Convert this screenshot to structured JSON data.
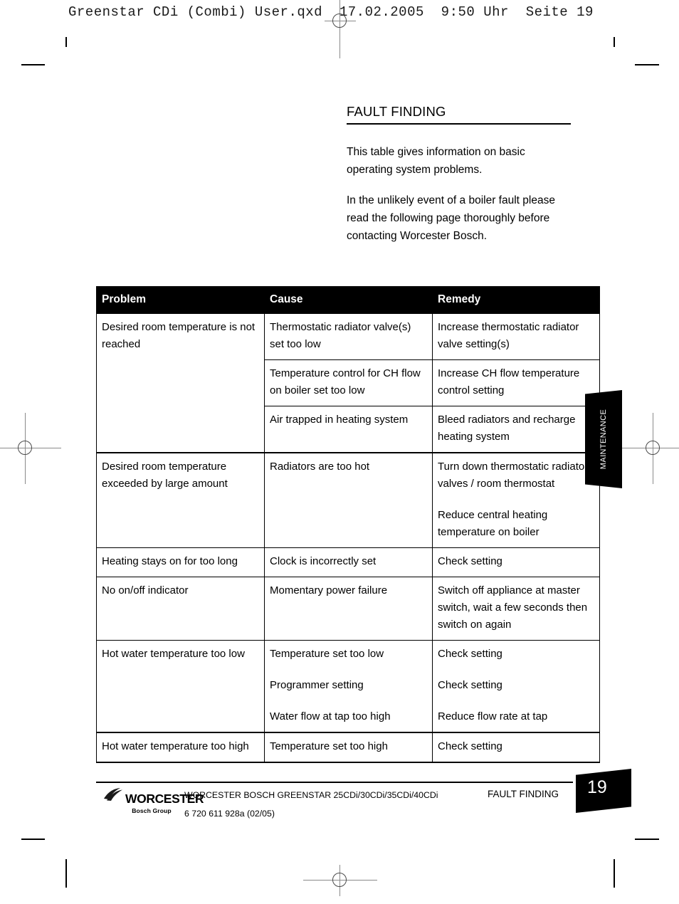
{
  "prepress": {
    "qxd_header": "Greenstar CDi (Combi) User.qxd  17.02.2005  9:50 Uhr  Seite 19"
  },
  "section": {
    "title": "FAULT FINDING",
    "paragraphs": [
      "This table gives information on basic operating system problems.",
      "In the unlikely event of a boiler fault please read the following page thoroughly before contacting Worcester Bosch."
    ]
  },
  "table": {
    "headers": [
      "Problem",
      "Cause",
      "Remedy"
    ],
    "rows": [
      {
        "problem": "Desired room temperature is not reached",
        "problem_rowspan": 3,
        "cause": [
          "Thermostatic radiator valve(s) set too low"
        ],
        "remedy": [
          "Increase thermostatic radiator valve setting(s)"
        ]
      },
      {
        "problem": null,
        "cause": [
          "Temperature control for CH flow on boiler set too low"
        ],
        "remedy": [
          "Increase CH flow temperature control setting"
        ]
      },
      {
        "problem": null,
        "cause": [
          "Air trapped in heating system"
        ],
        "remedy": [
          "Bleed radiators and recharge heating system"
        ]
      },
      {
        "problem": "Desired room temperature exceeded by large amount",
        "cause": [
          "Radiators are too hot"
        ],
        "remedy": [
          "Turn down thermostatic radiator valves / room thermostat",
          "Reduce central heating temperature on boiler"
        ]
      },
      {
        "problem": "Heating stays on for too long",
        "cause": [
          "Clock is incorrectly set"
        ],
        "remedy": [
          "Check setting"
        ]
      },
      {
        "problem": "No on/off indicator",
        "cause": [
          "Momentary power failure"
        ],
        "remedy": [
          "Switch off appliance at master switch, wait a few seconds then switch on again"
        ]
      },
      {
        "problem": "Hot water temperature too low",
        "cause": [
          "Temperature set too low",
          "Programmer setting",
          "Water flow at tap too high"
        ],
        "remedy": [
          "Check setting",
          "Check setting",
          "Reduce flow rate at tap"
        ]
      },
      {
        "problem": "Hot water temperature too high",
        "cause": [
          "Temperature set too high"
        ],
        "remedy": [
          "Check setting"
        ]
      }
    ]
  },
  "side_tab": {
    "label": "MAINTENANCE"
  },
  "footer": {
    "logo_word": "WORCESTER",
    "logo_sub": "Bosch Group",
    "product_line": "WORCESTER BOSCH GREENSTAR 25CDi/30CDi/35CDi/40CDi",
    "doc_number": "6 720 611 928a (02/05)",
    "section_label": "FAULT FINDING",
    "page_number": "19"
  },
  "colors": {
    "ink": "#000000",
    "paper": "#ffffff",
    "mark_grey": "#8a8a8a"
  }
}
